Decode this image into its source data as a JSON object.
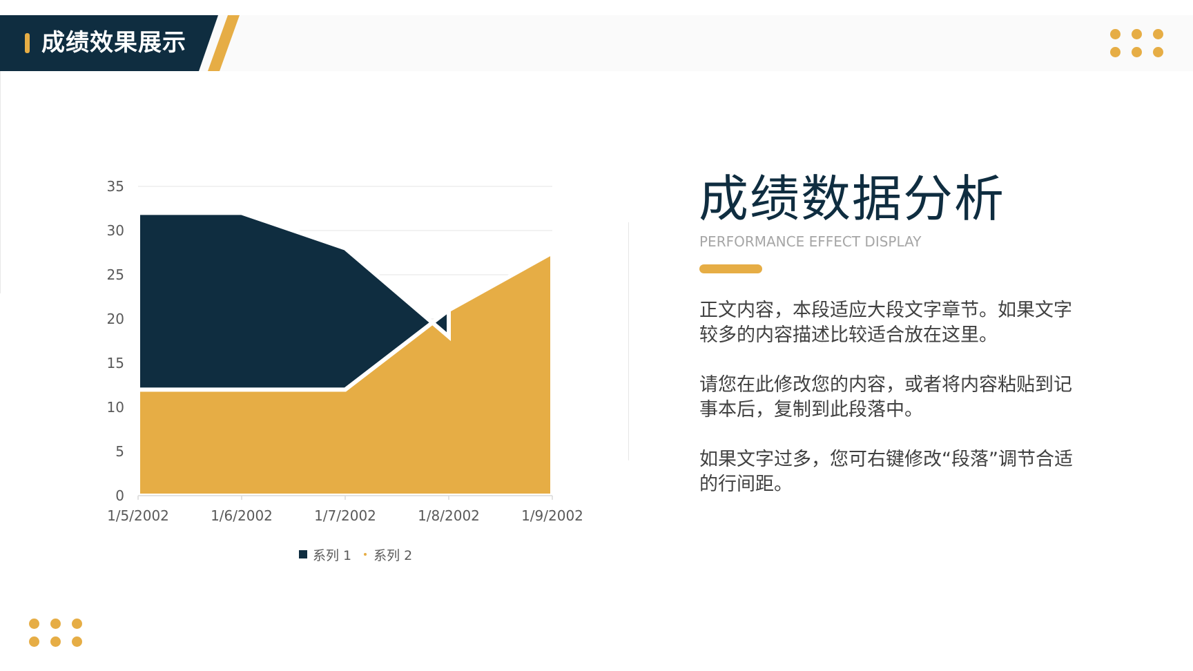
{
  "header": {
    "title": "成绩效果展示"
  },
  "panel": {
    "title": "成绩数据分析",
    "subtitle": "PERFORMANCE EFFECT DISPLAY",
    "paragraphs": [
      "正文内容，本段适应大段文字章节。如果文字较多的内容描述比较适合放在这里。",
      "请您在此修改您的内容，或者将内容粘贴到记事本后，复制到此段落中。",
      "如果文字过多，您可右键修改“段落”调节合适的行间距。"
    ]
  },
  "colors": {
    "navy": "#0f2d40",
    "gold": "#e6ad45",
    "text": "#404040",
    "muted": "#a6a6a6"
  },
  "chart_data": {
    "type": "area",
    "categories": [
      "1/5/2002",
      "1/6/2002",
      "1/7/2002",
      "1/8/2002",
      "1/9/2002"
    ],
    "series": [
      {
        "name": "系列 1",
        "values": [
          32,
          32,
          28,
          18,
          null
        ],
        "color": "#0f2d40"
      },
      {
        "name": "系列 2",
        "values": [
          12,
          12,
          12,
          21,
          27.5
        ],
        "color": "#e6ad45"
      }
    ],
    "ylim": [
      0,
      35
    ],
    "yticks": [
      0,
      5,
      10,
      15,
      20,
      25,
      30,
      35
    ],
    "grid": true,
    "legend": "bottom"
  }
}
